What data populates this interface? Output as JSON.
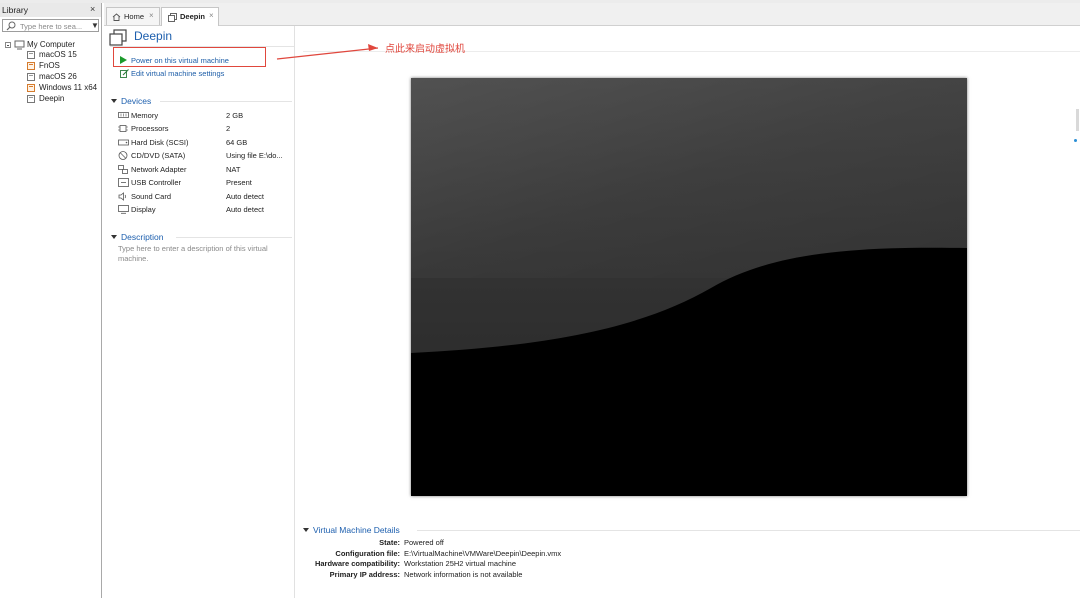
{
  "library": {
    "title": "Library",
    "close": "×",
    "search_placeholder": "Type here to sea...",
    "tree": {
      "root": "My Computer",
      "vms": [
        "macOS 15",
        "FnOS",
        "macOS 26",
        "Windows 11 x64",
        "Deepin"
      ]
    }
  },
  "tabs": [
    {
      "label": "Home",
      "icon": "home-icon"
    },
    {
      "label": "Deepin",
      "icon": "vm-icon",
      "active": true
    }
  ],
  "vm": {
    "name": "Deepin",
    "actions": {
      "power_on": "Power on this virtual machine",
      "edit_settings": "Edit virtual machine settings"
    },
    "devices_header": "Devices",
    "devices": [
      {
        "name": "Memory",
        "value": "2 GB",
        "icon": "memory-icon"
      },
      {
        "name": "Processors",
        "value": "2",
        "icon": "processor-icon"
      },
      {
        "name": "Hard Disk (SCSI)",
        "value": "64 GB",
        "icon": "hard-disk-icon"
      },
      {
        "name": "CD/DVD (SATA)",
        "value": "Using file E:\\do...",
        "icon": "cd-dvd-icon"
      },
      {
        "name": "Network Adapter",
        "value": "NAT",
        "icon": "network-icon"
      },
      {
        "name": "USB Controller",
        "value": "Present",
        "icon": "usb-icon"
      },
      {
        "name": "Sound Card",
        "value": "Auto detect",
        "icon": "sound-icon"
      },
      {
        "name": "Display",
        "value": "Auto detect",
        "icon": "display-icon"
      }
    ],
    "description_header": "Description",
    "description_placeholder": "Type here to enter a description of this virtual machine.",
    "details_header": "Virtual Machine Details",
    "details": [
      {
        "label": "State:",
        "value": "Powered off"
      },
      {
        "label": "Configuration file:",
        "value": "E:\\VirtualMachine\\VMWare\\Deepin\\Deepin.vmx"
      },
      {
        "label": "Hardware compatibility:",
        "value": "Workstation 25H2 virtual machine"
      },
      {
        "label": "Primary IP address:",
        "value": "Network information is not available"
      }
    ]
  },
  "annotation": {
    "text": "点此来启动虚拟机",
    "color": "#e0473d"
  },
  "colors": {
    "accent": "#1d5fae",
    "power_green": "#1c9a2c"
  }
}
